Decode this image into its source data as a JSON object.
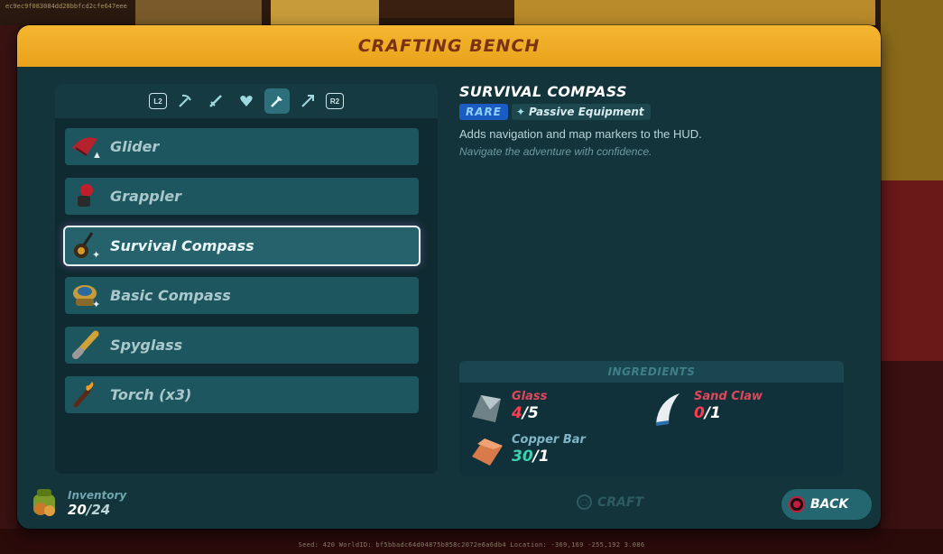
{
  "hud": {
    "seed_top": "ec9ec9f083084dd28bbfcd2cfe647eee",
    "bottom_info": "Seed: 420    WorldID:    bf5bbadc64d04875b858c2072e6a6db4    Location: -369,169  -255,192  3.086"
  },
  "window": {
    "title": "CRAFTING BENCH"
  },
  "category_tabs": [
    {
      "icon": "l2-bumper-icon",
      "label": "L2"
    },
    {
      "icon": "pickaxe-icon"
    },
    {
      "icon": "sword-icon"
    },
    {
      "icon": "heart-icon"
    },
    {
      "icon": "tool-icon",
      "active": true
    },
    {
      "icon": "arrow-icon"
    },
    {
      "icon": "r2-bumper-icon",
      "label": "R2"
    }
  ],
  "items": [
    {
      "label": "Glider",
      "icon": "glider-icon",
      "mark": "▲"
    },
    {
      "label": "Grappler",
      "icon": "grappler-icon",
      "mark": ""
    },
    {
      "label": "Survival Compass",
      "icon": "survival-compass-icon",
      "mark": "✦",
      "selected": true
    },
    {
      "label": "Basic Compass",
      "icon": "basic-compass-icon",
      "mark": "✦"
    },
    {
      "label": "Spyglass",
      "icon": "spyglass-icon",
      "mark": ""
    },
    {
      "label": "Torch (x3)",
      "icon": "torch-icon",
      "mark": ""
    }
  ],
  "detail": {
    "name": "SURVIVAL COMPASS",
    "rarity": "RARE",
    "type": "Passive Equipment",
    "description": "Adds navigation and map markers to the HUD.",
    "flavor": "Navigate the adventure with confidence."
  },
  "ingredients": {
    "header": "INGREDIENTS",
    "list": [
      {
        "name": "Glass",
        "have": "4",
        "need": "/5",
        "sufficient": false,
        "icon": "glass-icon"
      },
      {
        "name": "Sand Claw",
        "have": "0",
        "need": "/1",
        "sufficient": false,
        "icon": "sand-claw-icon"
      },
      {
        "name": "Copper Bar",
        "have": "30",
        "need": "/1",
        "sufficient": true,
        "icon": "copper-bar-icon"
      }
    ]
  },
  "footer": {
    "inventory_label": "Inventory",
    "inventory_used": "20",
    "inventory_max": "/24",
    "craft_label": "CRAFT",
    "back_label": "BACK"
  },
  "colors": {
    "title_bar": "#f5b631",
    "title_text": "#7a3210",
    "panel": "#13343a",
    "rarity_rare": "#1a5cc2",
    "missing": "#ff3b4e",
    "sufficient": "#3ad3b0"
  }
}
